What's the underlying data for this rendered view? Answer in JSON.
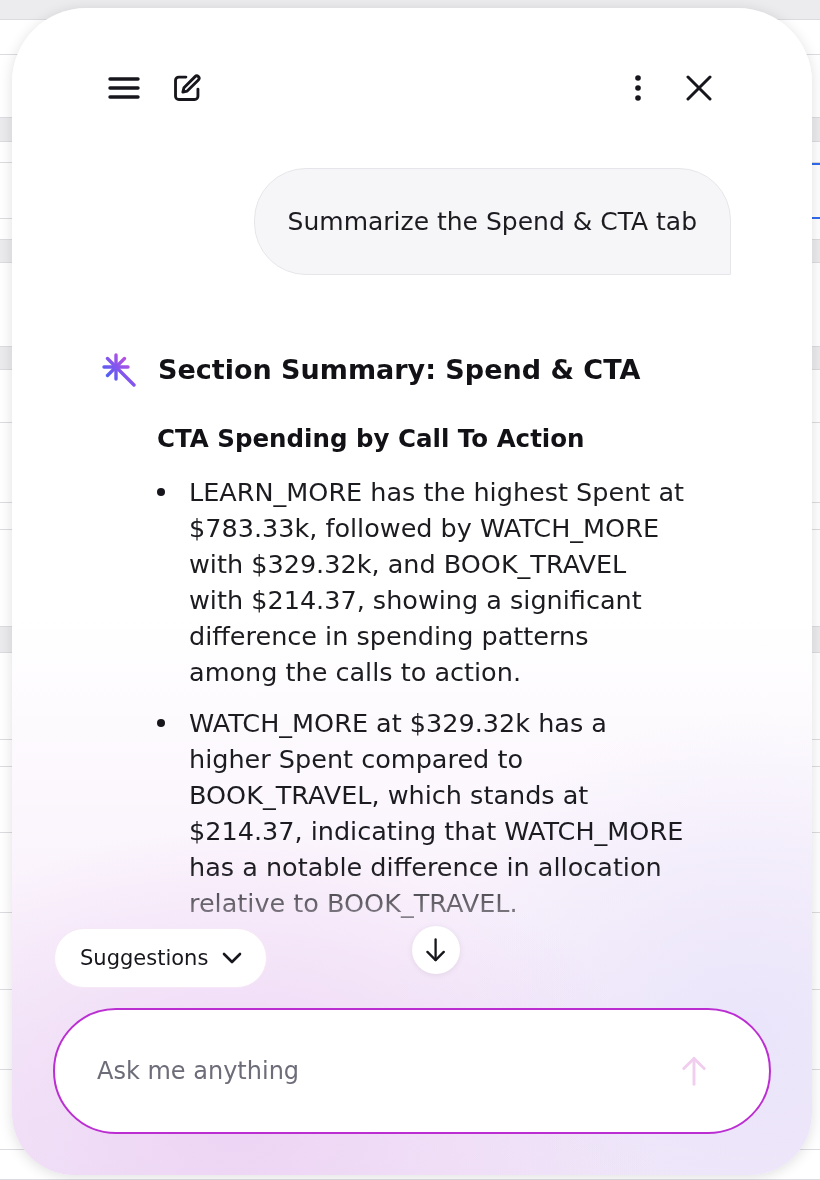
{
  "conversation": {
    "user_message": "Summarize the Spend & CTA tab",
    "response": {
      "title": "Section Summary: Spend & CTA",
      "sections": [
        {
          "heading": "CTA Spending by Call To Action",
          "bullets": [
            "LEARN_MORE has the highest Spent at $783.33k, followed by WATCH_MORE with $329.32k, and BOOK_TRAVEL with $214.37, showing a significant difference in spending patterns among the calls to action.",
            "WATCH_MORE at $329.32k has a higher Spent compared to BOOK_TRAVEL, which stands at $214.37, indicating that WATCH_MORE has a notable difference in allocation relative to BOOK_TRAVEL."
          ]
        }
      ]
    }
  },
  "suggestions": {
    "label": "Suggestions",
    "expanded": false
  },
  "composer": {
    "placeholder": "Ask me anything",
    "send_button": {
      "disabled": true
    }
  }
}
